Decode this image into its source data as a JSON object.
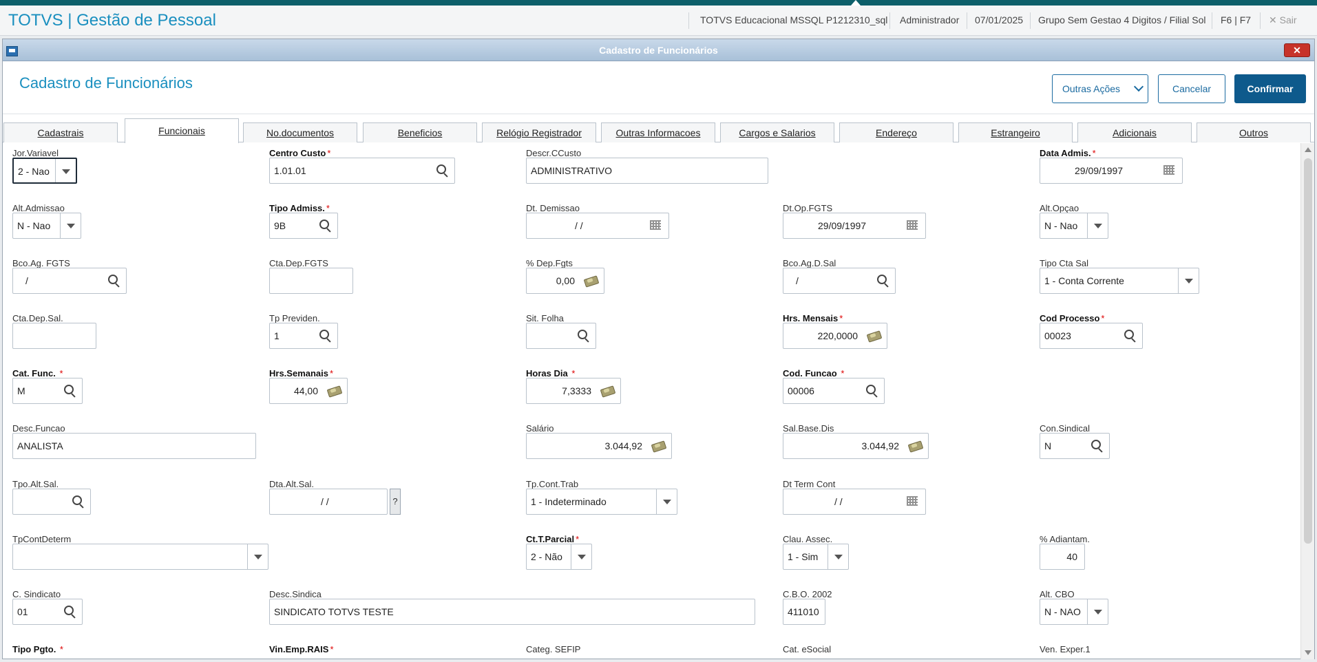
{
  "appbar": {
    "title": "TOTVS | Gestão de Pessoal",
    "environment": "TOTVS Educacional MSSQL P1212310_sql",
    "user": "Administrador",
    "date": "07/01/2025",
    "branch": "Grupo Sem Gestao 4 Digitos / Filial Sol",
    "shortcut": "F6 | F7",
    "exit_label": "✕  Sair"
  },
  "window": {
    "title": "Cadastro de Funcionários",
    "close_glyph": "✕"
  },
  "header": {
    "title": "Cadastro de Funcionários",
    "other_actions_label": "Outras Ações",
    "cancel_label": "Cancelar",
    "confirm_label": "Confirmar"
  },
  "tabs": [
    "Cadastrais",
    "Funcionais",
    "No.documentos",
    "Beneficios",
    "Relógio Registrador",
    "Outras Informacoes",
    "Cargos e Salarios",
    "Endereço",
    "Estrangeiro",
    "Adicionais",
    "Outros"
  ],
  "active_tab": "Funcionais",
  "form": {
    "jor_variavel": {
      "label": "Jor.Variavel",
      "value": "2 - Nao"
    },
    "centro_custo": {
      "label": "Centro Custo",
      "value": "1.01.01"
    },
    "descr_ccusto": {
      "label": "Descr.CCusto",
      "value": "ADMINISTRATIVO"
    },
    "data_admis": {
      "label": "Data Admis.",
      "value": "29/09/1997"
    },
    "alt_admissao": {
      "label": "Alt.Admissao",
      "value": "N - Nao"
    },
    "tipo_admiss": {
      "label": "Tipo Admiss.",
      "value": "9B"
    },
    "dt_demissao": {
      "label": "Dt. Demissao",
      "value": "/  /"
    },
    "dt_op_fgts": {
      "label": "Dt.Op.FGTS",
      "value": "29/09/1997"
    },
    "alt_opcao": {
      "label": "Alt.Opçao",
      "value": "N - Nao"
    },
    "bco_ag_fgts": {
      "label": "Bco.Ag. FGTS",
      "value": "/"
    },
    "cta_dep_fgts": {
      "label": "Cta.Dep.FGTS",
      "value": ""
    },
    "pct_dep_fgts": {
      "label": "% Dep.Fgts",
      "value": "0,00"
    },
    "bco_ag_d_sal": {
      "label": "Bco.Ag.D.Sal",
      "value": "/"
    },
    "tipo_cta_sal": {
      "label": "Tipo Cta Sal",
      "value": "1 - Conta Corrente"
    },
    "cta_dep_sal": {
      "label": "Cta.Dep.Sal.",
      "value": ""
    },
    "tp_previden": {
      "label": "Tp Previden.",
      "value": "1"
    },
    "sit_folha": {
      "label": "Sit. Folha",
      "value": ""
    },
    "hrs_mensais": {
      "label": "Hrs. Mensais",
      "value": "220,0000"
    },
    "cod_processo": {
      "label": "Cod Processo",
      "value": "00023"
    },
    "cat_func": {
      "label": "Cat. Func. ",
      "value": "M"
    },
    "hrs_semanais": {
      "label": "Hrs.Semanais",
      "value": "44,00"
    },
    "horas_dia": {
      "label": "Horas Dia ",
      "value": "7,3333"
    },
    "cod_funcao": {
      "label": "Cod. Funcao ",
      "value": "00006"
    },
    "desc_funcao": {
      "label": "Desc.Funcao",
      "value": "ANALISTA"
    },
    "salario": {
      "label": "Salário",
      "value": "3.044,92"
    },
    "sal_base_dis": {
      "label": "Sal.Base.Dis",
      "value": "3.044,92"
    },
    "con_sindical": {
      "label": "Con.Sindical",
      "value": "N"
    },
    "tpo_alt_sal": {
      "label": "Tpo.Alt.Sal.",
      "value": ""
    },
    "dta_alt_sal": {
      "label": "Dta.Alt.Sal.",
      "value": "/  /",
      "help": "?"
    },
    "tp_cont_trab": {
      "label": "Tp.Cont.Trab",
      "value": "1 - Indeterminado"
    },
    "dt_term_cont": {
      "label": "Dt Term Cont",
      "value": "/  /"
    },
    "tp_cont_determ": {
      "label": "TpContDeterm",
      "value": ""
    },
    "ct_t_parcial": {
      "label": "Ct.T.Parcial",
      "value": "2 - Não"
    },
    "clau_assec": {
      "label": "Clau. Assec.",
      "value": "1 - Sim"
    },
    "pct_adiantam": {
      "label": "% Adiantam.",
      "value": "40"
    },
    "c_sindicato": {
      "label": "C. Sindicato",
      "value": "01"
    },
    "desc_sindica": {
      "label": "Desc.Sindica",
      "value": "SINDICATO TOTVS TESTE"
    },
    "cbo_2002": {
      "label": "C.B.O. 2002",
      "value": "411010"
    },
    "alt_cbo": {
      "label": "Alt. CBO",
      "value": "N - NAO"
    },
    "tipo_pgto": {
      "label": "Tipo Pgto. "
    },
    "vin_emp_rais": {
      "label": "Vin.Emp.RAIS"
    },
    "categ_sefip": {
      "label": "Categ. SEFIP"
    },
    "cat_esocial": {
      "label": "Cat. eSocial"
    },
    "ven_exper1": {
      "label": "Ven. Exper.1"
    }
  }
}
